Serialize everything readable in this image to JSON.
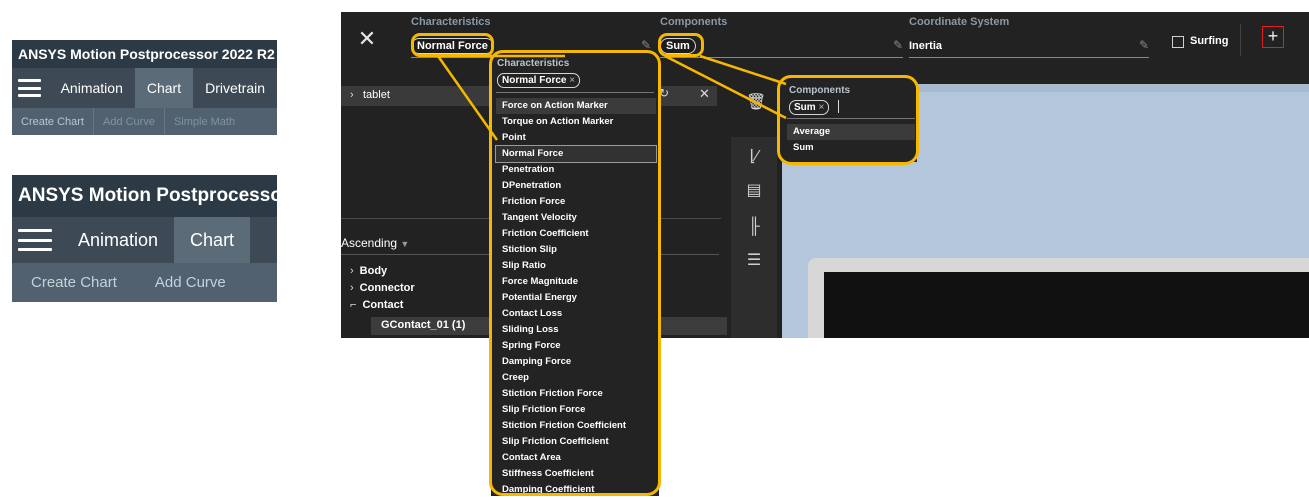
{
  "mini_panel_small": {
    "title": "ANSYS Motion Postprocessor  2022 R2 -",
    "tabs": [
      "Animation",
      "Chart",
      "Drivetrain"
    ],
    "subtoolbar": [
      "Create Chart",
      "Add Curve",
      "Simple Math"
    ]
  },
  "mini_panel_large": {
    "title": "ANSYS Motion Postprocesso",
    "tabs": [
      "Animation",
      "Chart"
    ],
    "subtoolbar": [
      "Create Chart",
      "Add Curve"
    ]
  },
  "header": {
    "characteristics_label": "Characteristics",
    "characteristics_value": "Normal Force",
    "components_label": "Components",
    "components_value": "Sum",
    "coordinate_label": "Coordinate System",
    "coordinate_value": "Inertia",
    "surfing_label": "Surfing"
  },
  "tree": {
    "top_item": "tablet",
    "sort_label": "Ascending",
    "nodes": [
      "Body",
      "Connector",
      "Contact"
    ],
    "selected_child": "GContact_01 (1)"
  },
  "characteristics_dropdown": {
    "label": "Characteristics",
    "chip": "Normal Force",
    "options": [
      "Force on Action Marker",
      "Torque on Action Marker",
      "Point",
      "Normal Force",
      "Penetration",
      "DPenetration",
      "Friction Force",
      "Tangent Velocity",
      "Friction Coefficient",
      "Stiction Slip",
      "Slip Ratio",
      "Force Magnitude",
      "Potential Energy",
      "Contact Loss",
      "Sliding Loss",
      "Spring Force",
      "Damping Force",
      "Creep",
      "Stiction Friction Force",
      "Slip Friction Force",
      "Stiction Friction Coefficient",
      "Slip Friction Coefficient",
      "Contact Area",
      "Stiffness Coefficient",
      "Damping Coefficient"
    ]
  },
  "components_dropdown": {
    "label": "Components",
    "chip": "Sum",
    "options": [
      "Average",
      "Sum"
    ]
  },
  "colors": {
    "highlight": "#f5b700",
    "plus_border": "#e02020",
    "viewport": "#b3c6dc"
  }
}
